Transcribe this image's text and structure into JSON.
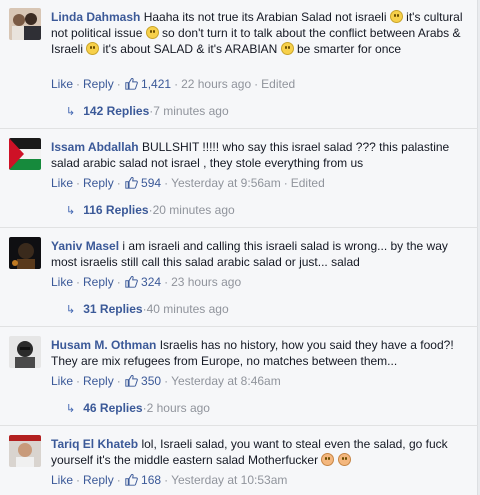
{
  "ui": {
    "like_label": "Like",
    "reply_label": "Reply",
    "sep": "·",
    "edited_label": "Edited"
  },
  "comments": [
    {
      "author": "Linda Dahmash",
      "text_parts": [
        "Haaha its not true its Arabian Salad not israeli ",
        " it's cultural not political issue ",
        " so don't turn it to talk about the conflict between Arabs & Israeli ",
        " it's about SALAD & it's ARABIAN ",
        " be smarter for once"
      ],
      "likes": "1,421",
      "time": "22 hours ago",
      "replies_label": "142 Replies",
      "replies_time": "7 minutes ago"
    },
    {
      "author": "Issam Abdallah",
      "text": "BULLSHIT !!!!! who say this israel salad ??? this palastine salad arabic salad not israel , they stole everything from us",
      "likes": "594",
      "time": "Yesterday at 9:56am",
      "replies_label": "116 Replies",
      "replies_time": "20 minutes ago"
    },
    {
      "author": "Yaniv Masel",
      "text": "i am israeli and calling this israeli salad is wrong... by the way most israelis still call this salad arabic salad or just... salad",
      "likes": "324",
      "time": "23 hours ago",
      "replies_label": "31 Replies",
      "replies_time": "40 minutes ago"
    },
    {
      "author": "Husam M. Othman",
      "text": "Israelis has no history, how you said they have a food?! They are mix refugees from Europe, no matches between them...",
      "likes": "350",
      "time": "Yesterday at 8:46am",
      "replies_label": "46 Replies",
      "replies_time": "2 hours ago"
    },
    {
      "author": "Tariq El Khateb",
      "text": "lol, Israeli salad, you want to steal even the salad, go fuck yourself it's the middle eastern salad Motherfucker",
      "likes": "168",
      "time": "Yesterday at 10:53am"
    }
  ],
  "colors": {
    "link": "#3b5998",
    "meta": "#90949c",
    "background": "#f6f7f9"
  },
  "icons": {
    "like": "thumbs-up-icon",
    "reply_arrow": "reply-arrow-icon",
    "emoji": "smile-emoji-icon"
  }
}
